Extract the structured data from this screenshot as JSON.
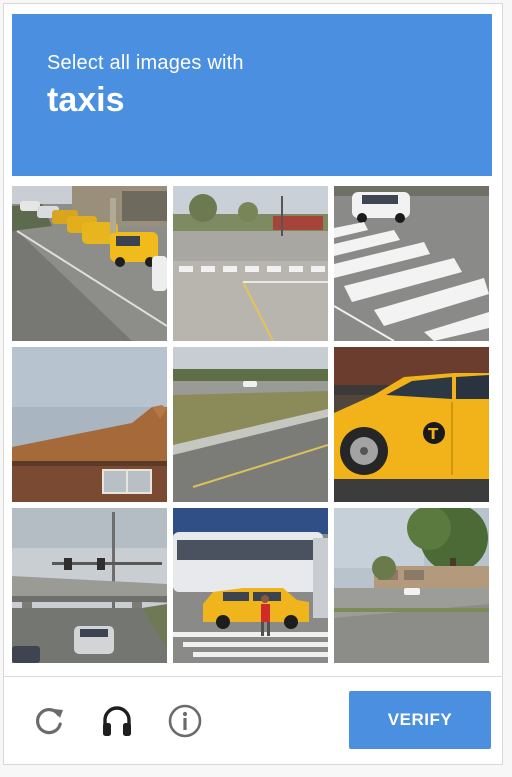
{
  "header": {
    "instruction": "Select all images with",
    "target": "taxis"
  },
  "grid": {
    "tiles": [
      {
        "scene": "taxi-line-street"
      },
      {
        "scene": "intersection-crosswalk"
      },
      {
        "scene": "zebra-crosswalk-suv"
      },
      {
        "scene": "building-roof"
      },
      {
        "scene": "road-grass-median"
      },
      {
        "scene": "yellow-taxi-closeup"
      },
      {
        "scene": "highway-overpass"
      },
      {
        "scene": "bus-taxi-pedestrian"
      },
      {
        "scene": "parking-lot-tree"
      }
    ]
  },
  "footer": {
    "reload_icon": "reload-icon",
    "audio_icon": "headphones-icon",
    "info_icon": "info-icon",
    "verify_label": "VERIFY"
  },
  "colors": {
    "accent": "#4a8fe0",
    "icon_gray": "#6b6b6b"
  }
}
